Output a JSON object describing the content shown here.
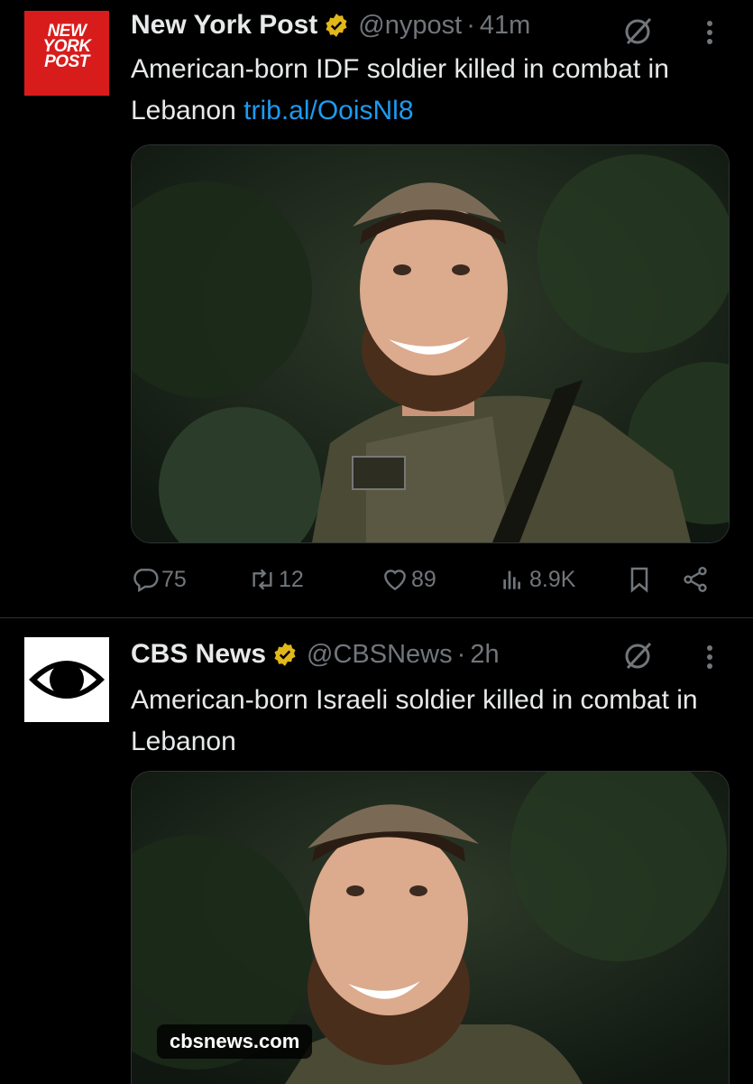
{
  "tweets": [
    {
      "name": "New York Post",
      "handle": "@nypost",
      "separator": "·",
      "time": "41m",
      "text": "American-born IDF soldier killed in combat in Lebanon",
      "link": "trib.al/OoisNl8",
      "logo_lines": [
        "NEW",
        "YORK",
        "POST"
      ],
      "metrics": {
        "replies": "75",
        "reposts": "12",
        "likes": "89",
        "views": "8.9K"
      }
    },
    {
      "name": "CBS News",
      "handle": "@CBSNews",
      "separator": "·",
      "time": "2h",
      "text": "American-born Israeli soldier killed in combat in Lebanon",
      "link_card_domain": "cbsnews.com"
    }
  ],
  "colors": {
    "background": "#000000",
    "link": "#1d9bf0",
    "muted": "#71767b",
    "verified_gold": "#e2b719",
    "nyp_red": "#d81c1c"
  },
  "icons": [
    "verified-badge-icon",
    "grok-icon",
    "more-icon",
    "reply-icon",
    "repost-icon",
    "like-icon",
    "views-icon",
    "bookmark-icon",
    "share-icon"
  ]
}
